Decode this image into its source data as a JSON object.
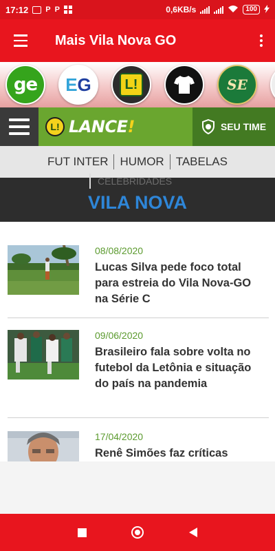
{
  "status_bar": {
    "time": "17:12",
    "speed": "0,6KB/s",
    "battery": "100",
    "notification_icons": [
      "image-icon",
      "p-icon",
      "p-icon",
      "windows-icon"
    ],
    "notif_p1": "P",
    "notif_p2": "P"
  },
  "app_bar": {
    "title": "Mais Vila Nova GO"
  },
  "logos": [
    {
      "name": "ge-logo",
      "text": "ge"
    },
    {
      "name": "eg-logo",
      "text_e": "E",
      "text_g": "G"
    },
    {
      "name": "lance-circle-logo",
      "text": "L!"
    },
    {
      "name": "shirt-logo",
      "text": "T"
    },
    {
      "name": "se-logo",
      "text": "SE"
    }
  ],
  "lance": {
    "brand": "LANCE",
    "brand_mark": "!",
    "badge": "L!",
    "seu_time": "SEU TIME"
  },
  "categories": [
    "FUT INTER",
    "HUMOR",
    "TABELAS",
    "CELEBRIDADES"
  ],
  "section": {
    "title": "VILA NOVA"
  },
  "articles": [
    {
      "date": "08/08/2020",
      "headline": "Lucas Silva pede foco total para estreia do Vila Nova-GO na Série C"
    },
    {
      "date": "09/06/2020",
      "headline": "Brasileiro fala sobre volta no futebol da Letônia e situação do país na pandemia"
    },
    {
      "date": "17/04/2020",
      "headline": "Renê Simões faz críticas"
    }
  ],
  "colors": {
    "brand_red": "#e8151e",
    "lance_green": "#6aa62f",
    "section_blue": "#2e86d8",
    "date_green": "#5b9a2e"
  }
}
